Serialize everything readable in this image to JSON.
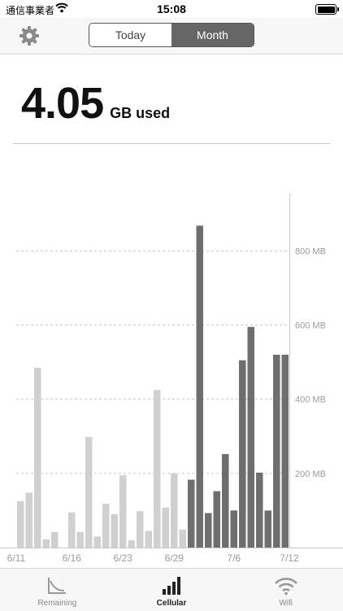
{
  "status_bar": {
    "carrier": "通信事業者",
    "time": "15:08"
  },
  "segments": {
    "today": "Today",
    "month": "Month",
    "selected": "Month"
  },
  "usage": {
    "value": "4.05",
    "unit": "GB used"
  },
  "chart_data": {
    "type": "bar",
    "ylim": [
      0,
      950
    ],
    "y_ticks": [
      {
        "value": 200,
        "label": "200 MB"
      },
      {
        "value": 400,
        "label": "400 MB"
      },
      {
        "value": 600,
        "label": "600 MB"
      },
      {
        "value": 800,
        "label": "800 MB"
      }
    ],
    "x_labels": [
      "6/11",
      "6/16",
      "6/23",
      "6/29",
      "7/6",
      "7/12"
    ],
    "x_label_index": [
      0,
      6,
      12,
      18,
      25,
      31
    ],
    "colors": {
      "previous": "#d0d0d0",
      "current": "#6e6e6e",
      "grid": "#c8c8c8",
      "axis_text": "#9a9a9a"
    },
    "series": [
      {
        "values": [
          125,
          148,
          485,
          22,
          42,
          0,
          95,
          42,
          298,
          30,
          118,
          90,
          195,
          20,
          98,
          45,
          425,
          108,
          200,
          48
        ],
        "color_key": "previous"
      },
      {
        "values": [
          183,
          93,
          152,
          252,
          100,
          505,
          595,
          202,
          100,
          520,
          520
        ],
        "color_key": "current"
      }
    ],
    "peak_value": 868,
    "peak_index": 21
  },
  "tabs": [
    {
      "label": "Remaining",
      "icon": "remaining-chart-icon"
    },
    {
      "label": "Cellular",
      "icon": "cellular-bars-icon"
    },
    {
      "label": "Wifi",
      "icon": "wifi-icon"
    }
  ],
  "active_tab": "Cellular"
}
